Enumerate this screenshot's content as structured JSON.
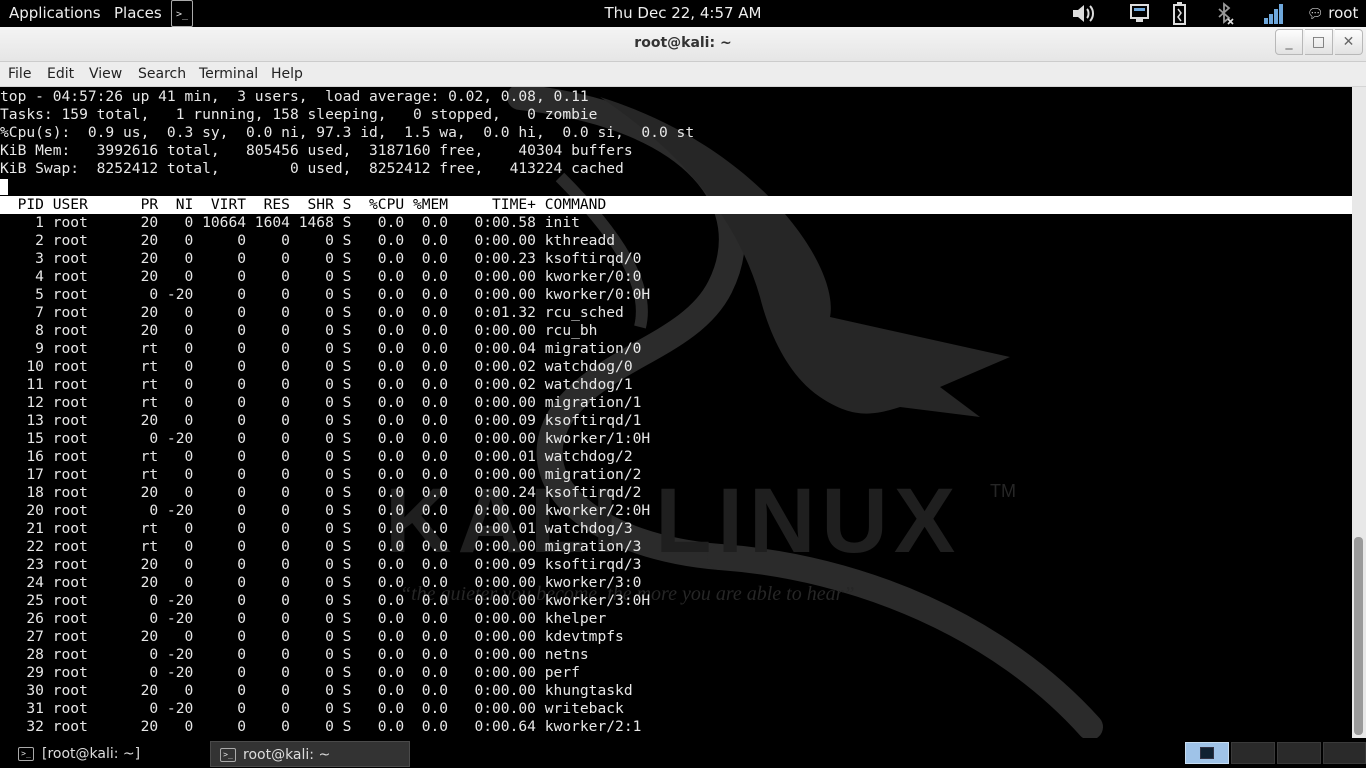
{
  "panel": {
    "applications": "Applications",
    "places": "Places",
    "terminal_launcher_glyph": ">_",
    "clock": "Thu Dec 22,  4:57 AM",
    "user": "root",
    "icons": [
      "speaker-icon",
      "network-icon",
      "battery-icon",
      "bluetooth-disabled-icon",
      "signal-icon",
      "chat-icon"
    ]
  },
  "window": {
    "title": "root@kali: ~",
    "minimize": "_",
    "maximize": "□",
    "close": "✕"
  },
  "menubar": {
    "file": "File",
    "edit": "Edit",
    "view": "View",
    "search": "Search",
    "terminal": "Terminal",
    "help": "Help"
  },
  "top": {
    "summary": [
      "top - 04:57:26 up 41 min,  3 users,  load average: 0.02, 0.08, 0.11",
      "Tasks: 159 total,   1 running, 158 sleeping,   0 stopped,   0 zombie",
      "%Cpu(s):  0.9 us,  0.3 sy,  0.0 ni, 97.3 id,  1.5 wa,  0.0 hi,  0.0 si,  0.0 st",
      "KiB Mem:   3992616 total,   805456 used,  3187160 free,    40304 buffers",
      "KiB Swap:  8252412 total,        0 used,  8252412 free,   413224 cached"
    ],
    "columns": [
      "PID",
      "USER",
      "PR",
      "NI",
      "VIRT",
      "RES",
      "SHR",
      "S",
      "%CPU",
      "%MEM",
      "TIME+",
      "COMMAND"
    ],
    "processes": [
      [
        "1",
        "root",
        "20",
        "0",
        "10664",
        "1604",
        "1468",
        "S",
        "0.0",
        "0.0",
        "0:00.58",
        "init"
      ],
      [
        "2",
        "root",
        "20",
        "0",
        "0",
        "0",
        "0",
        "S",
        "0.0",
        "0.0",
        "0:00.00",
        "kthreadd"
      ],
      [
        "3",
        "root",
        "20",
        "0",
        "0",
        "0",
        "0",
        "S",
        "0.0",
        "0.0",
        "0:00.23",
        "ksoftirqd/0"
      ],
      [
        "4",
        "root",
        "20",
        "0",
        "0",
        "0",
        "0",
        "S",
        "0.0",
        "0.0",
        "0:00.00",
        "kworker/0:0"
      ],
      [
        "5",
        "root",
        "0",
        "-20",
        "0",
        "0",
        "0",
        "S",
        "0.0",
        "0.0",
        "0:00.00",
        "kworker/0:0H"
      ],
      [
        "7",
        "root",
        "20",
        "0",
        "0",
        "0",
        "0",
        "S",
        "0.0",
        "0.0",
        "0:01.32",
        "rcu_sched"
      ],
      [
        "8",
        "root",
        "20",
        "0",
        "0",
        "0",
        "0",
        "S",
        "0.0",
        "0.0",
        "0:00.00",
        "rcu_bh"
      ],
      [
        "9",
        "root",
        "rt",
        "0",
        "0",
        "0",
        "0",
        "S",
        "0.0",
        "0.0",
        "0:00.04",
        "migration/0"
      ],
      [
        "10",
        "root",
        "rt",
        "0",
        "0",
        "0",
        "0",
        "S",
        "0.0",
        "0.0",
        "0:00.02",
        "watchdog/0"
      ],
      [
        "11",
        "root",
        "rt",
        "0",
        "0",
        "0",
        "0",
        "S",
        "0.0",
        "0.0",
        "0:00.02",
        "watchdog/1"
      ],
      [
        "12",
        "root",
        "rt",
        "0",
        "0",
        "0",
        "0",
        "S",
        "0.0",
        "0.0",
        "0:00.00",
        "migration/1"
      ],
      [
        "13",
        "root",
        "20",
        "0",
        "0",
        "0",
        "0",
        "S",
        "0.0",
        "0.0",
        "0:00.09",
        "ksoftirqd/1"
      ],
      [
        "15",
        "root",
        "0",
        "-20",
        "0",
        "0",
        "0",
        "S",
        "0.0",
        "0.0",
        "0:00.00",
        "kworker/1:0H"
      ],
      [
        "16",
        "root",
        "rt",
        "0",
        "0",
        "0",
        "0",
        "S",
        "0.0",
        "0.0",
        "0:00.01",
        "watchdog/2"
      ],
      [
        "17",
        "root",
        "rt",
        "0",
        "0",
        "0",
        "0",
        "S",
        "0.0",
        "0.0",
        "0:00.00",
        "migration/2"
      ],
      [
        "18",
        "root",
        "20",
        "0",
        "0",
        "0",
        "0",
        "S",
        "0.0",
        "0.0",
        "0:00.24",
        "ksoftirqd/2"
      ],
      [
        "20",
        "root",
        "0",
        "-20",
        "0",
        "0",
        "0",
        "S",
        "0.0",
        "0.0",
        "0:00.00",
        "kworker/2:0H"
      ],
      [
        "21",
        "root",
        "rt",
        "0",
        "0",
        "0",
        "0",
        "S",
        "0.0",
        "0.0",
        "0:00.01",
        "watchdog/3"
      ],
      [
        "22",
        "root",
        "rt",
        "0",
        "0",
        "0",
        "0",
        "S",
        "0.0",
        "0.0",
        "0:00.00",
        "migration/3"
      ],
      [
        "23",
        "root",
        "20",
        "0",
        "0",
        "0",
        "0",
        "S",
        "0.0",
        "0.0",
        "0:00.09",
        "ksoftirqd/3"
      ],
      [
        "24",
        "root",
        "20",
        "0",
        "0",
        "0",
        "0",
        "S",
        "0.0",
        "0.0",
        "0:00.00",
        "kworker/3:0"
      ],
      [
        "25",
        "root",
        "0",
        "-20",
        "0",
        "0",
        "0",
        "S",
        "0.0",
        "0.0",
        "0:00.00",
        "kworker/3:0H"
      ],
      [
        "26",
        "root",
        "0",
        "-20",
        "0",
        "0",
        "0",
        "S",
        "0.0",
        "0.0",
        "0:00.00",
        "khelper"
      ],
      [
        "27",
        "root",
        "20",
        "0",
        "0",
        "0",
        "0",
        "S",
        "0.0",
        "0.0",
        "0:00.00",
        "kdevtmpfs"
      ],
      [
        "28",
        "root",
        "0",
        "-20",
        "0",
        "0",
        "0",
        "S",
        "0.0",
        "0.0",
        "0:00.00",
        "netns"
      ],
      [
        "29",
        "root",
        "0",
        "-20",
        "0",
        "0",
        "0",
        "S",
        "0.0",
        "0.0",
        "0:00.00",
        "perf"
      ],
      [
        "30",
        "root",
        "20",
        "0",
        "0",
        "0",
        "0",
        "S",
        "0.0",
        "0.0",
        "0:00.00",
        "khungtaskd"
      ],
      [
        "31",
        "root",
        "0",
        "-20",
        "0",
        "0",
        "0",
        "S",
        "0.0",
        "0.0",
        "0:00.00",
        "writeback"
      ],
      [
        "32",
        "root",
        "20",
        "0",
        "0",
        "0",
        "0",
        "S",
        "0.0",
        "0.0",
        "0:00.64",
        "kworker/2:1"
      ]
    ]
  },
  "wallpaper": {
    "logo_text": "KALI LINUX",
    "trademark": "TM",
    "slogan": "“the quieter you become, the more you are able to hear”"
  },
  "taskbar": {
    "task1": "[root@kali: ~]",
    "task2": "root@kali: ~",
    "task_glyph": ">_"
  }
}
